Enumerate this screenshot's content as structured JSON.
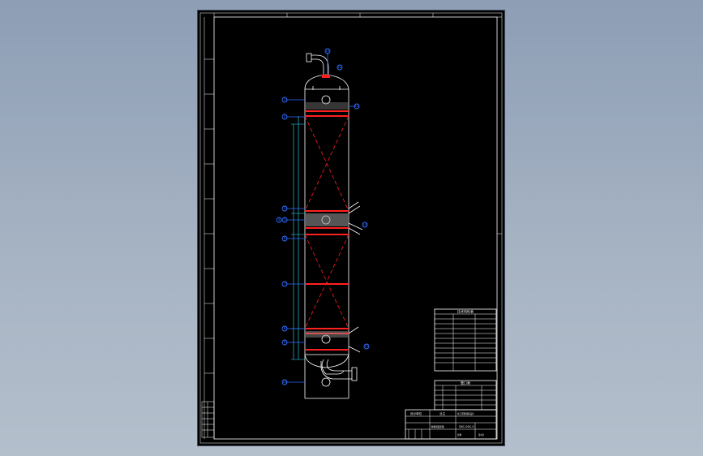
{
  "drawing": {
    "sheet_background": "#000000",
    "line_color": "#ffffff",
    "accent_red": "#ff2020",
    "dimension_blue": "#2f6cff"
  },
  "title_block": {
    "company_label": "设计单位",
    "owner_label": "业主",
    "drawing_title": "精馏塔装配图",
    "drawing_number": "SXC-001-0",
    "project_label": "化工原理课程设计",
    "scale_label": "比例",
    "sheet_label": "第1张"
  },
  "tech_table": {
    "title": "技术特性表"
  },
  "nozzle_table": {
    "title": "管口表"
  }
}
